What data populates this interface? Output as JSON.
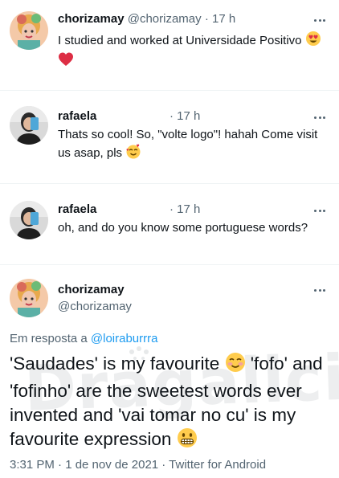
{
  "tweets": [
    {
      "display_name": "chorizamay",
      "handle": "@chorizamay",
      "time": "· 17 h",
      "text": "I studied and worked at Universidade Positivo"
    },
    {
      "display_name": "rafaela",
      "time": "· 17 h",
      "text": "Thats so cool! So, \"volte logo\"! hahah Come visit us asap, pls"
    },
    {
      "display_name": "rafaela",
      "time": "· 17 h",
      "text": "oh, and do you know some portuguese words?"
    }
  ],
  "main_tweet": {
    "display_name": "chorizamay",
    "handle": "@chorizamay",
    "reply_prefix": "Em resposta a",
    "reply_to": "@loiraburrra",
    "text_part1": "'Saudades' is my favourite",
    "text_part2": "'fofo' and 'fofinho' are the sweetest words ever invented and 'vai tomar no cu' is my favourite expression",
    "timestamp": "3:31 PM · 1 de nov de 2021 · Twitter for Android"
  },
  "watermark": "Dragalicious",
  "colors": {
    "text": "#0f1419",
    "secondary": "#536471",
    "link": "#1d9bf0",
    "divider": "#eff3f4"
  },
  "icons": [
    "heart-eyes-emoji",
    "red-heart-emoji",
    "smiling-hearts-emoji",
    "blushing-emoji",
    "grimacing-emoji",
    "more-icon"
  ]
}
